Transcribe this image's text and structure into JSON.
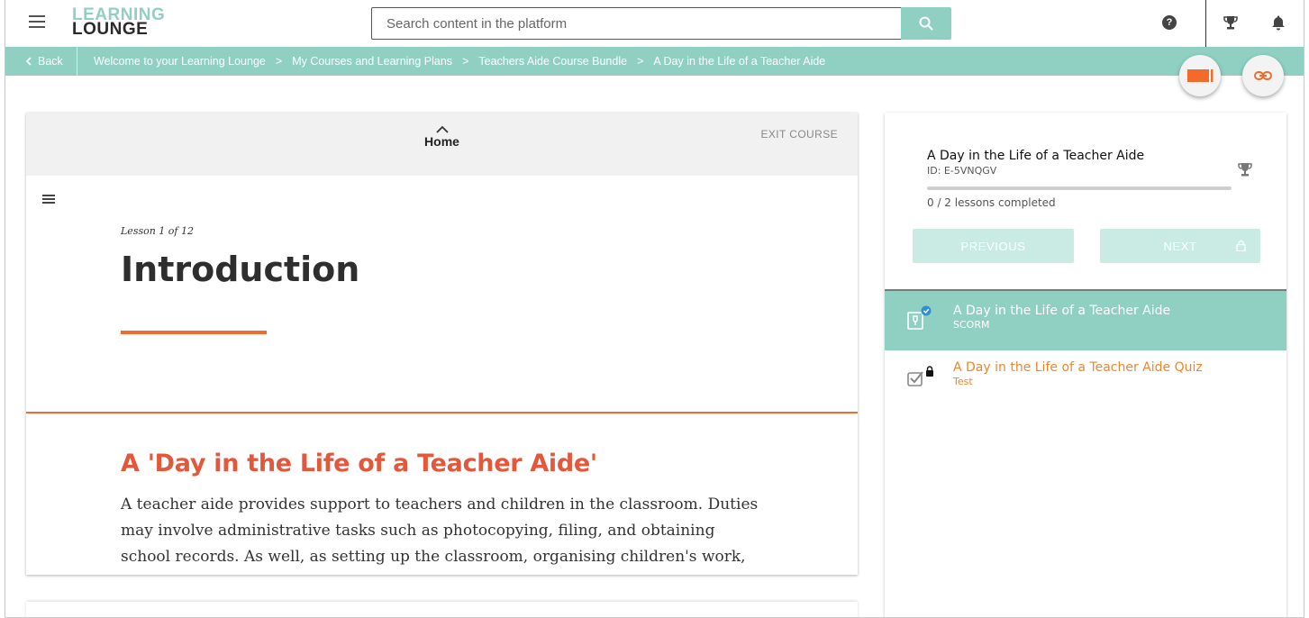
{
  "header": {
    "logo_line1": "LEARNING",
    "logo_line2": "LOUNGE",
    "search_placeholder": "Search content in the platform"
  },
  "breadcrumb": {
    "back_label": "Back",
    "items": [
      "Welcome to your Learning Lounge",
      "My Courses and Learning Plans",
      "Teachers Aide Course Bundle",
      "A Day in the Life of a Teacher Aide"
    ],
    "separator": ">"
  },
  "player": {
    "home_label": "Home",
    "exit_label": "EXIT COURSE",
    "lesson_count": "Lesson 1 of 12",
    "lesson_title": "Introduction",
    "section_title": "A 'Day in the Life of a Teacher Aide'",
    "body_lines": [
      "A teacher aide provides support to teachers and children in the classroom. Duties",
      "may involve administrative tasks such as photocopying, filing, and obtaining",
      "school records. As well, as setting up the classroom, organising children's work,"
    ]
  },
  "side_panel": {
    "course_title": "A Day in the Life of a Teacher Aide",
    "course_id": "ID: E-5VNQGV",
    "progress_fraction": 0,
    "lessons_completed": "0 / 2 lessons completed",
    "previous_label": "PREVIOUS",
    "next_label": "NEXT",
    "items": [
      {
        "title": "A Day in the Life of a Teacher Aide",
        "type": "SCORM",
        "icon": "scorm-package-icon",
        "status": "completed"
      },
      {
        "title": "A Day in the Life of a Teacher Aide Quiz",
        "type": "Test",
        "icon": "test-checkbox-icon",
        "status": "locked"
      }
    ]
  },
  "colors": {
    "brand_teal": "#8fd0c3",
    "accent_orange": "#f26b2a",
    "section_title_red": "#e4573b",
    "quiz_orange": "#f0852a",
    "nav_button_disabled": "#c9ebe4"
  },
  "icons": [
    "hamburger-icon",
    "search-icon",
    "help-icon",
    "trophy-icon",
    "bell-icon",
    "chevron-left-icon",
    "tag-icon",
    "link-icon",
    "chevron-up-icon",
    "lock-icon",
    "check-badge-icon"
  ]
}
